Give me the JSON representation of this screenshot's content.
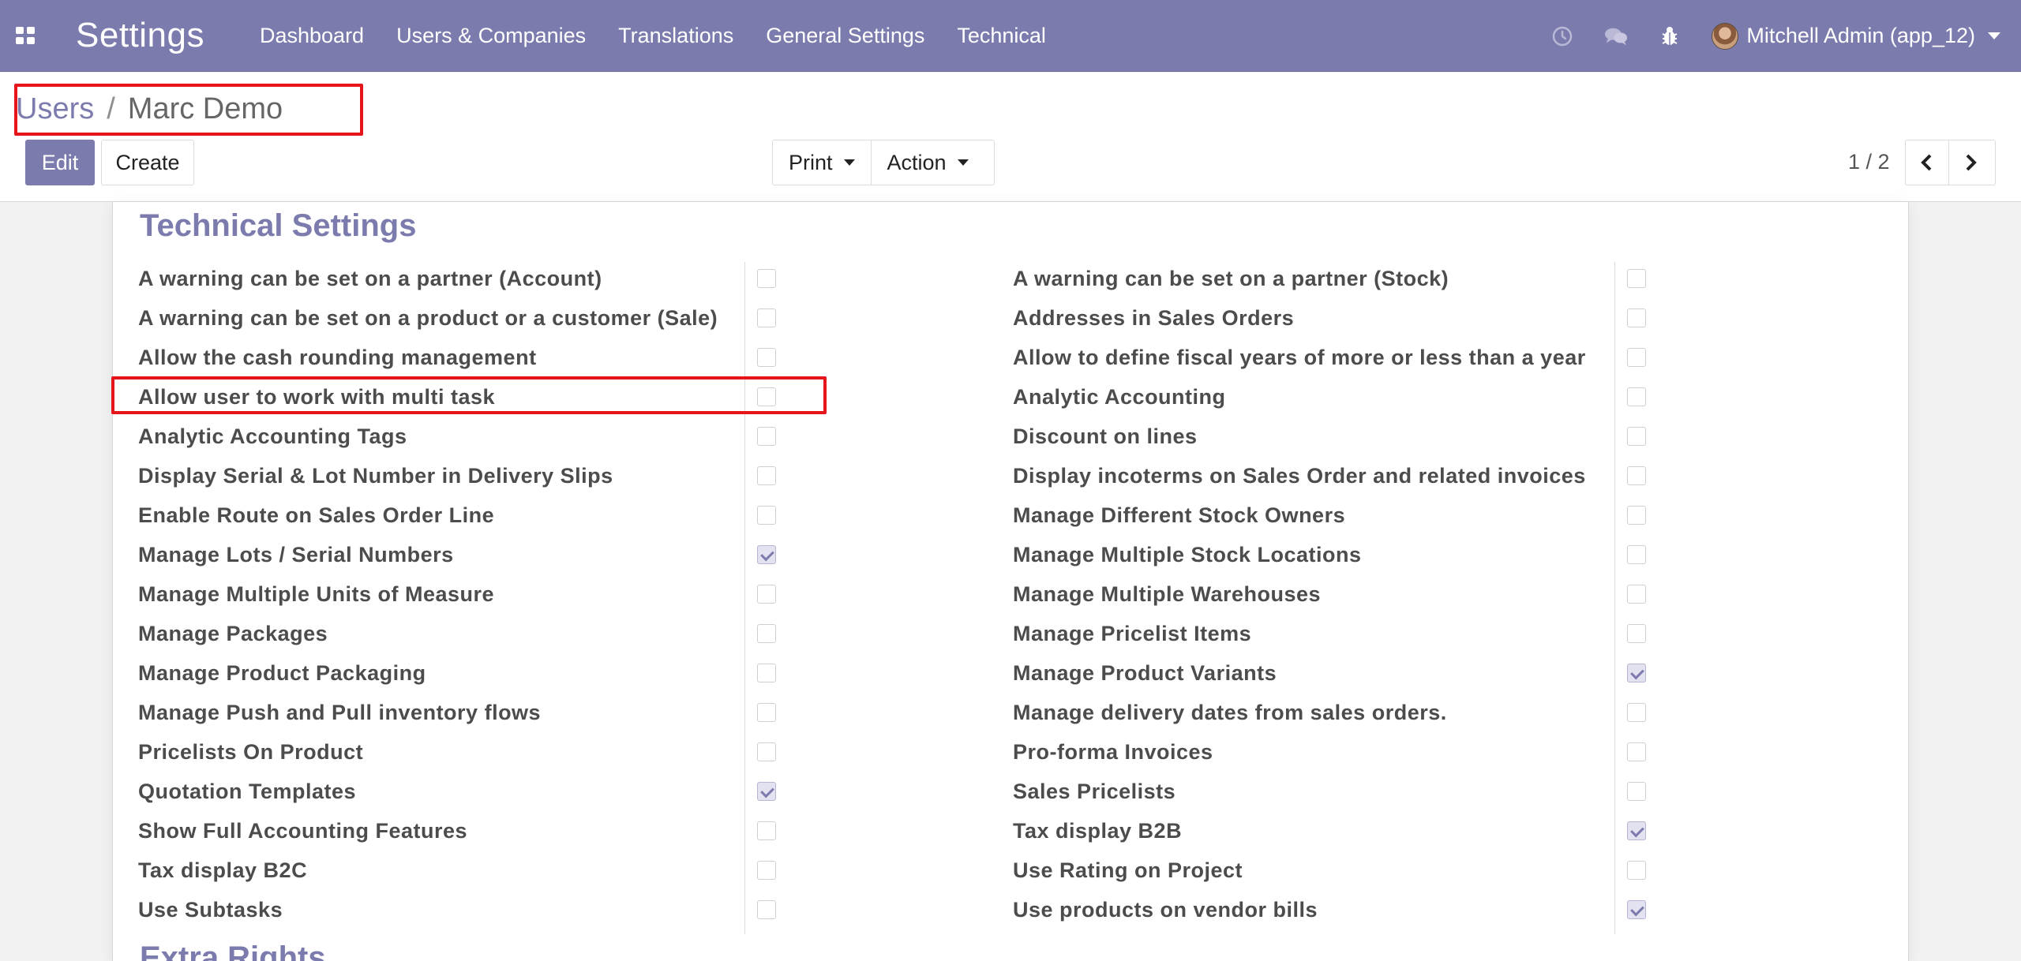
{
  "navbar": {
    "brand": "Settings",
    "menu": [
      "Dashboard",
      "Users & Companies",
      "Translations",
      "General Settings",
      "Technical"
    ],
    "user": "Mitchell Admin (app_12)",
    "icons": [
      "clock-icon",
      "chat-icon",
      "bug-icon"
    ]
  },
  "breadcrumb": {
    "parent": "Users",
    "separator": "/",
    "current": "Marc Demo"
  },
  "buttons": {
    "edit": "Edit",
    "create": "Create",
    "print": "Print",
    "action": "Action"
  },
  "pager": {
    "value": "1 / 2"
  },
  "section": {
    "title": "Technical Settings",
    "next_title": "Extra Rights",
    "left": [
      {
        "label": "A warning can be set on a partner (Account)",
        "checked": false
      },
      {
        "label": "A warning can be set on a product or a customer (Sale)",
        "checked": false
      },
      {
        "label": "Allow the cash rounding management",
        "checked": false
      },
      {
        "label": "Allow user to work with multi task",
        "checked": false
      },
      {
        "label": "Analytic Accounting Tags",
        "checked": false
      },
      {
        "label": "Display Serial & Lot Number in Delivery Slips",
        "checked": false
      },
      {
        "label": "Enable Route on Sales Order Line",
        "checked": false
      },
      {
        "label": "Manage Lots / Serial Numbers",
        "checked": true
      },
      {
        "label": "Manage Multiple Units of Measure",
        "checked": false
      },
      {
        "label": "Manage Packages",
        "checked": false
      },
      {
        "label": "Manage Product Packaging",
        "checked": false
      },
      {
        "label": "Manage Push and Pull inventory flows",
        "checked": false
      },
      {
        "label": "Pricelists On Product",
        "checked": false
      },
      {
        "label": "Quotation Templates",
        "checked": true
      },
      {
        "label": "Show Full Accounting Features",
        "checked": false
      },
      {
        "label": "Tax display B2C",
        "checked": false
      },
      {
        "label": "Use Subtasks",
        "checked": false
      }
    ],
    "right": [
      {
        "label": "A warning can be set on a partner (Stock)",
        "checked": false
      },
      {
        "label": "Addresses in Sales Orders",
        "checked": false
      },
      {
        "label": "Allow to define fiscal years of more or less than a year",
        "checked": false
      },
      {
        "label": "Analytic Accounting",
        "checked": false
      },
      {
        "label": "Discount on lines",
        "checked": false
      },
      {
        "label": "Display incoterms on Sales Order and related invoices",
        "checked": false
      },
      {
        "label": "Manage Different Stock Owners",
        "checked": false
      },
      {
        "label": "Manage Multiple Stock Locations",
        "checked": false
      },
      {
        "label": "Manage Multiple Warehouses",
        "checked": false
      },
      {
        "label": "Manage Pricelist Items",
        "checked": false
      },
      {
        "label": "Manage Product Variants",
        "checked": true
      },
      {
        "label": "Manage delivery dates from sales orders.",
        "checked": false
      },
      {
        "label": "Pro-forma Invoices",
        "checked": false
      },
      {
        "label": "Sales Pricelists",
        "checked": false
      },
      {
        "label": "Tax display B2B",
        "checked": true
      },
      {
        "label": "Use Rating on Project",
        "checked": false
      },
      {
        "label": "Use products on vendor bills",
        "checked": true
      }
    ]
  },
  "colors": {
    "brand": "#7c7bad",
    "highlight": "#e6141b"
  }
}
